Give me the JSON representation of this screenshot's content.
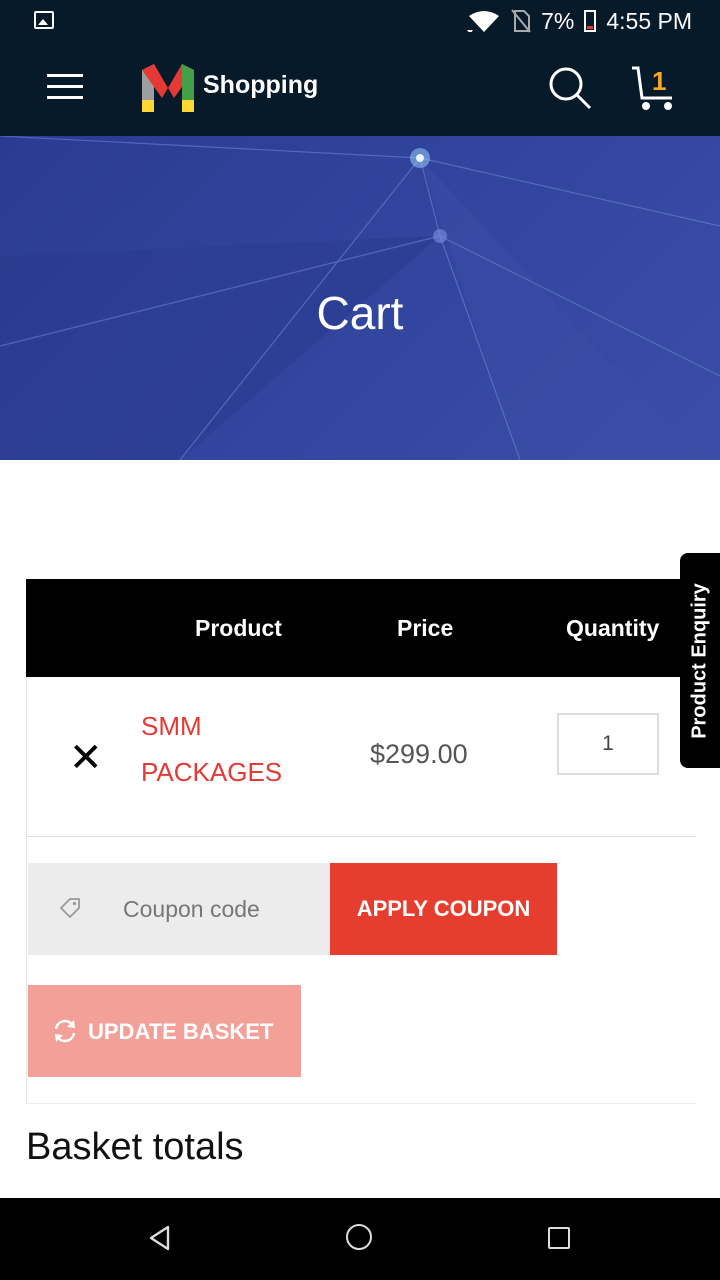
{
  "status_bar": {
    "battery": "7%",
    "time": "4:55 PM"
  },
  "header": {
    "brand": "Shopping",
    "cart_count": "1"
  },
  "hero": {
    "title": "Cart"
  },
  "table": {
    "headers": {
      "product": "Product",
      "price": "Price",
      "quantity": "Quantity"
    },
    "rows": [
      {
        "product": "SMM PACKAGES",
        "price": "$299.00",
        "quantity": "1"
      }
    ]
  },
  "coupon": {
    "placeholder": "Coupon code",
    "apply_label": "APPLY COUPON"
  },
  "update_label": "UPDATE BASKET",
  "totals_title": "Basket totals",
  "side_tab": "Product Enquiry",
  "colors": {
    "accent": "#e63e2e",
    "dark_header": "#071a2a",
    "hero_blue": "#31459f"
  }
}
